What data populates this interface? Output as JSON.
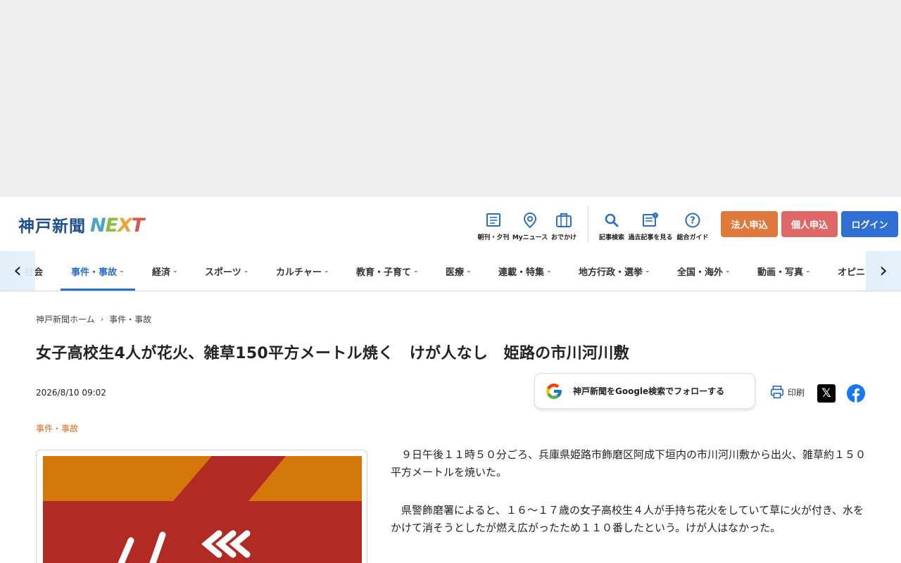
{
  "header": {
    "logo_text": "神戸新聞",
    "logo_next": [
      "N",
      "E",
      "X",
      "T"
    ],
    "utilities": [
      {
        "label": "朝刊・夕刊",
        "icon": "newspaper-icon"
      },
      {
        "label": "Myニュース",
        "icon": "map-pin-icon"
      },
      {
        "label": "おでかけ",
        "icon": "suitcase-icon"
      },
      {
        "label": "記事検索",
        "icon": "search-icon"
      },
      {
        "label": "過去記事を見る",
        "icon": "archive-icon"
      },
      {
        "label": "総合ガイド",
        "icon": "help-icon"
      }
    ],
    "buttons": {
      "corporate": "法人申込",
      "personal": "個人申込",
      "login": "ログイン"
    },
    "colors": {
      "corporate": "#e07a3c",
      "personal": "#e06768",
      "login": "#2f6fd4"
    }
  },
  "nav": {
    "items": [
      {
        "label": "社会",
        "chevron": ""
      },
      {
        "label": "事件・事故",
        "chevron": "⌄"
      },
      {
        "label": "経済",
        "chevron": "⌄"
      },
      {
        "label": "スポーツ",
        "chevron": "⌄"
      },
      {
        "label": "カルチャー",
        "chevron": "⌄"
      },
      {
        "label": "教育・子育て",
        "chevron": "⌄"
      },
      {
        "label": "医療",
        "chevron": "⌄"
      },
      {
        "label": "連載・特集",
        "chevron": "⌄"
      },
      {
        "label": "地方行政・選挙",
        "chevron": "⌄"
      },
      {
        "label": "全国・海外",
        "chevron": "⌄"
      },
      {
        "label": "動画・写真",
        "chevron": "⌄"
      },
      {
        "label": "オピニオン",
        "chevron": ""
      }
    ],
    "active_index": 1,
    "prev_arrow": "‹",
    "next_arrow": "›"
  },
  "breadcrumb": {
    "home": "神戸新聞ホーム",
    "separator": "›",
    "current": "事件・事故"
  },
  "article": {
    "title": "女子高校生4人が花火、雑草150平方メートル焼く　けが人なし　姫路の市川河川敷",
    "date": "2026/8/10 09:02",
    "category": "事件・事故",
    "google_follow": "神戸新聞をGoogle検索でフォローする",
    "print_label": "印刷",
    "x_label": "𝕏",
    "paragraphs": [
      "９日午後１１時５０分ごろ、兵庫県姫路市飾磨区阿成下垣内の市川河川敷から出火、雑草約１５０平方メートルを焼いた。",
      "県警飾磨署によると、１６～１７歳の女子高校生４人が手持ち花火をしていて草に火が付き、水をかけて消そうとしたが燃え広がったため１１０番したという。けが人はなかった。"
    ]
  }
}
